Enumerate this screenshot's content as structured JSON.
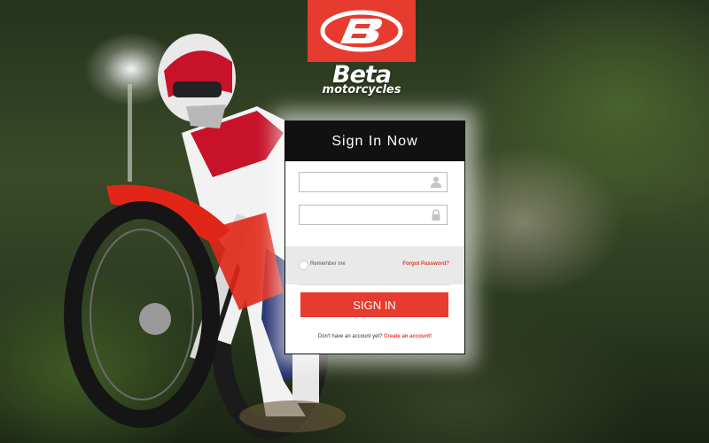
{
  "brand": {
    "name": "Beta",
    "tagline": "motorcycles",
    "logo_color": "#e63b2e"
  },
  "panel": {
    "title": "Sign In Now",
    "username": {
      "value": "",
      "placeholder": "",
      "icon": "user-icon"
    },
    "password": {
      "value": "",
      "placeholder": "",
      "icon": "lock-icon"
    },
    "remember_label": "Remember me",
    "forgot_label": "Forgot Password?",
    "signin_label": "SIGN IN",
    "no_account_text": "Don't have an account yet?",
    "create_link": "Create an account!"
  },
  "colors": {
    "accent": "#e63b2e",
    "header_bg": "#111111"
  }
}
